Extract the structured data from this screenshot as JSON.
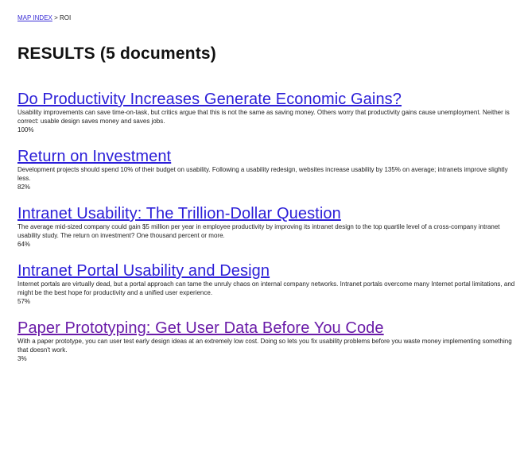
{
  "breadcrumb": {
    "link_label": "MAP INDEX",
    "separator": " > ",
    "current": "ROI"
  },
  "page_title": "RESULTS (5 documents)",
  "results": [
    {
      "title": "Do Productivity Increases Generate Economic Gains?",
      "description": "Usability improvements can save time-on-task, but critics argue that this is not the same as saving money. Others worry that productivity gains cause unemployment. Neither is correct: usable design saves money and saves jobs.",
      "score": "100%"
    },
    {
      "title": "Return on Investment",
      "description": "Development projects should spend 10% of their budget on usability. Following a usability redesign, websites increase usability by 135% on average; intranets improve slightly less.",
      "score": "82%"
    },
    {
      "title": "Intranet Usability: The Trillion-Dollar Question",
      "description": "The average mid-sized company could gain $5 million per year in employee productivity by improving its intranet design to the top quartile level of a cross-company intranet usability study. The return on investment? One thousand percent or more.",
      "score": "64%"
    },
    {
      "title": "Intranet Portal Usability and Design",
      "description": "Internet portals are virtually dead, but a portal approach can tame the unruly chaos on internal company networks. Intranet portals overcome many Internet portal limitations, and might be the best hope for productivity and a unified user experience.",
      "score": "57%"
    },
    {
      "title": "Paper Prototyping: Get User Data Before You Code",
      "description": "With a paper prototype, you can user test early design ideas at an extremely low cost. Doing so lets you fix usability problems before you waste money implementing something that doesn't work.",
      "score": "3%"
    }
  ],
  "colors": {
    "link": "#2b1ed8",
    "visited_link": "#6a1ba8",
    "text": "#222222",
    "background": "#ffffff"
  }
}
